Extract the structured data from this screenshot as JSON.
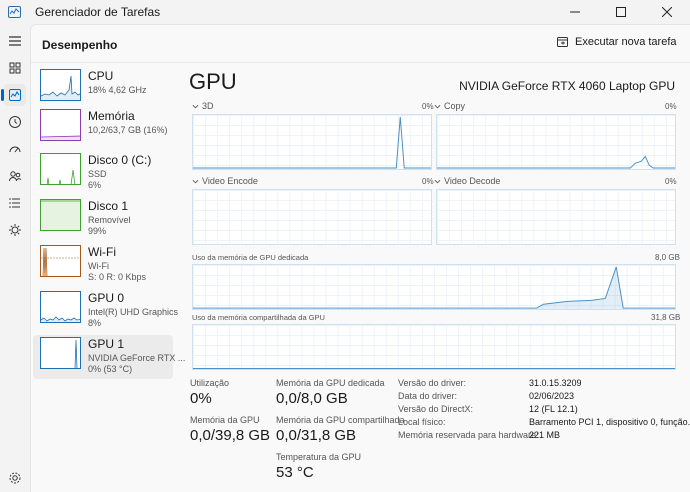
{
  "window": {
    "title": "Gerenciador de Tarefas",
    "controls": [
      "minimize-icon",
      "maximize-icon",
      "close-icon"
    ]
  },
  "nav": {
    "items": [
      {
        "icon": "hamburger-menu-icon"
      },
      {
        "icon": "processes-icon"
      },
      {
        "icon": "performance-icon",
        "active": true
      },
      {
        "icon": "app-history-icon"
      },
      {
        "icon": "startup-apps-icon"
      },
      {
        "icon": "users-icon"
      },
      {
        "icon": "details-icon"
      },
      {
        "icon": "services-icon"
      },
      {
        "icon": "settings-icon"
      }
    ]
  },
  "header": {
    "page_title": "Desempenho",
    "run_task_label": "Executar nova tarefa"
  },
  "devices": [
    {
      "name": "CPU",
      "sub1": "18%  4,62 GHz",
      "sub2": "",
      "color": "#1f6fb5"
    },
    {
      "name": "Memória",
      "sub1": "10,2/63,7 GB (16%)",
      "sub2": "",
      "color": "#8c3fa8"
    },
    {
      "name": "Disco 0 (C:)",
      "sub1": "SSD",
      "sub2": "6%",
      "color": "#3f9f2f"
    },
    {
      "name": "Disco 1",
      "sub1": "Removível",
      "sub2": "99%",
      "color": "#3f9f2f"
    },
    {
      "name": "Wi-Fi",
      "sub1": "Wi-Fi",
      "sub2": "S: 0  R: 0 Kbps",
      "color": "#a35a1c"
    },
    {
      "name": "GPU 0",
      "sub1": "Intel(R) UHD Graphics",
      "sub2": "8%",
      "color": "#1f6fb5"
    },
    {
      "name": "GPU 1",
      "sub1": "NVIDIA GeForce RTX ...",
      "sub2": "0% (53 °C)",
      "color": "#1f6fb5",
      "selected": true
    }
  ],
  "gpu": {
    "title": "GPU",
    "model": "NVIDIA GeForce RTX 4060 Laptop GPU",
    "engines": [
      {
        "label": "3D",
        "pct": "0%"
      },
      {
        "label": "Copy",
        "pct": "0%"
      },
      {
        "label": "Video Encode",
        "pct": "0%"
      },
      {
        "label": "Video Decode",
        "pct": "0%"
      }
    ],
    "dedicated_mem": {
      "label": "Uso da memória de GPU dedicada",
      "max": "8,0 GB"
    },
    "shared_mem": {
      "label": "Uso da memória compartilhada da GPU",
      "max": "31,8 GB"
    }
  },
  "stats": {
    "utilization": {
      "label": "Utilização",
      "value": "0%"
    },
    "gpu_memory": {
      "label": "Memória da GPU",
      "value": "0,0/39,8 GB"
    },
    "dedicated_memory": {
      "label": "Memória da GPU dedicada",
      "value": "0,0/8,0 GB"
    },
    "shared_memory": {
      "label": "Memória da GPU compartilhada",
      "value": "0,0/31,8 GB"
    },
    "temperature": {
      "label": "Temperatura da GPU",
      "value": "53 °C"
    }
  },
  "info": [
    {
      "key": "Versão do driver:",
      "value": "31.0.15.3209"
    },
    {
      "key": "Data do driver:",
      "value": "02/06/2023"
    },
    {
      "key": "Versão do DirectX:",
      "value": "12 (FL 12.1)"
    },
    {
      "key": "Local físico:",
      "value": "Barramento PCI 1, dispositivo 0, função..."
    },
    {
      "key": "Memória reservada para hardware:",
      "value": "221 MB"
    }
  ],
  "colors": {
    "accent": "#0067c0",
    "graph_line": "#4a90c8",
    "graph_border": "#cfe0f0"
  }
}
